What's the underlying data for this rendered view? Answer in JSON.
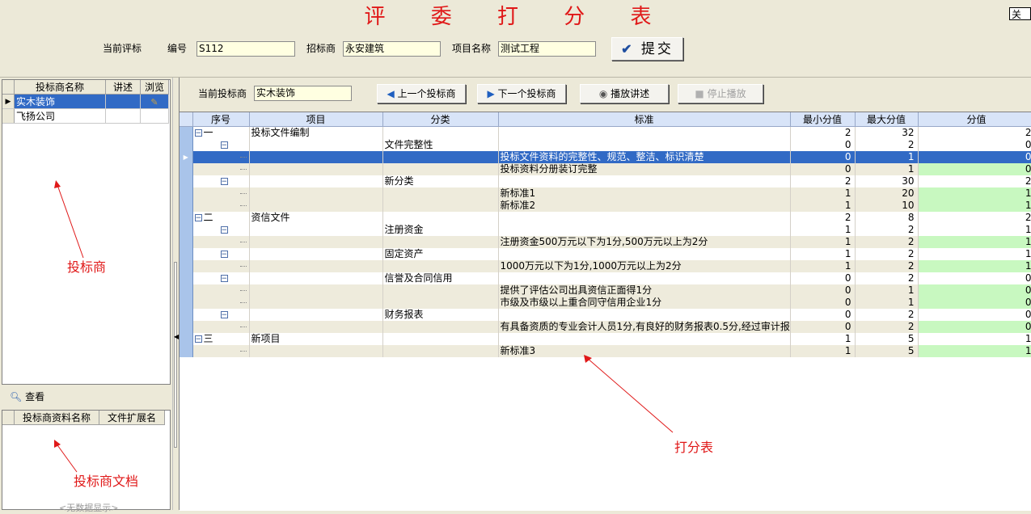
{
  "header": {
    "title": "评 委 打 分 表",
    "close_label": "关闭",
    "current_bid_label": "当前评标",
    "number_label": "编号",
    "number_value": "S112",
    "tenderer_label": "招标商",
    "tenderer_value": "永安建筑",
    "project_label": "项目名称",
    "project_value": "测试工程",
    "submit_label": "提交"
  },
  "bidders": {
    "columns": [
      "投标商名称",
      "讲述",
      "浏览"
    ],
    "rows": [
      {
        "name": "实木装饰"
      },
      {
        "name": "飞扬公司"
      }
    ],
    "annotation": "投标商"
  },
  "docs": {
    "view_label": "查看",
    "columns": [
      "投标商资料名称",
      "文件扩展名"
    ],
    "empty_text": "<无数据显示>",
    "annotation": "投标商文档"
  },
  "toolbar": {
    "current_bidder_label": "当前投标商",
    "current_bidder_value": "实木装饰",
    "prev_label": "上一个投标商",
    "next_label": "下一个投标商",
    "play_label": "播放讲述",
    "stop_label": "停止播放"
  },
  "score": {
    "columns": [
      "序号",
      "项目",
      "分类",
      "标准",
      "最小分值",
      "最大分值",
      "分值"
    ],
    "rows": [
      {
        "level": 0,
        "seq": "一",
        "project": "投标文件编制",
        "category": "",
        "standard": "",
        "min": "2",
        "max": "32",
        "score": "2"
      },
      {
        "level": 1,
        "seq": "",
        "project": "",
        "category": "文件完整性",
        "standard": "",
        "min": "0",
        "max": "2",
        "score": "0"
      },
      {
        "level": 2,
        "seq": "",
        "project": "",
        "category": "",
        "standard": "投标文件资料的完整性、规范、整洁、标识清楚",
        "min": "0",
        "max": "1",
        "score": "0",
        "selected": true
      },
      {
        "level": 2,
        "seq": "",
        "project": "",
        "category": "",
        "standard": "投标资料分册装订完整",
        "min": "0",
        "max": "1",
        "score": "0"
      },
      {
        "level": 1,
        "seq": "",
        "project": "",
        "category": "新分类",
        "standard": "",
        "min": "2",
        "max": "30",
        "score": "2"
      },
      {
        "level": 2,
        "seq": "",
        "project": "",
        "category": "",
        "standard": "新标准1",
        "min": "1",
        "max": "20",
        "score": "1"
      },
      {
        "level": 2,
        "seq": "",
        "project": "",
        "category": "",
        "standard": "新标准2",
        "min": "1",
        "max": "10",
        "score": "1"
      },
      {
        "level": 0,
        "seq": "二",
        "project": "资信文件",
        "category": "",
        "standard": "",
        "min": "2",
        "max": "8",
        "score": "2"
      },
      {
        "level": 1,
        "seq": "",
        "project": "",
        "category": "注册资金",
        "standard": "",
        "min": "1",
        "max": "2",
        "score": "1"
      },
      {
        "level": 2,
        "seq": "",
        "project": "",
        "category": "",
        "standard": "注册资金500万元以下为1分,500万元以上为2分",
        "min": "1",
        "max": "2",
        "score": "1"
      },
      {
        "level": 1,
        "seq": "",
        "project": "",
        "category": "固定资产",
        "standard": "",
        "min": "1",
        "max": "2",
        "score": "1"
      },
      {
        "level": 2,
        "seq": "",
        "project": "",
        "category": "",
        "standard": "1000万元以下为1分,1000万元以上为2分",
        "min": "1",
        "max": "2",
        "score": "1"
      },
      {
        "level": 1,
        "seq": "",
        "project": "",
        "category": "信誉及合同信用",
        "standard": "",
        "min": "0",
        "max": "2",
        "score": "0"
      },
      {
        "level": 2,
        "seq": "",
        "project": "",
        "category": "",
        "standard": "提供了评估公司出具资信正面得1分",
        "min": "0",
        "max": "1",
        "score": "0"
      },
      {
        "level": 2,
        "seq": "",
        "project": "",
        "category": "",
        "standard": "市级及市级以上重合同守信用企业1分",
        "min": "0",
        "max": "1",
        "score": "0"
      },
      {
        "level": 1,
        "seq": "",
        "project": "",
        "category": "财务报表",
        "standard": "",
        "min": "0",
        "max": "2",
        "score": "0"
      },
      {
        "level": 2,
        "seq": "",
        "project": "",
        "category": "",
        "standard": "有具备资质的专业会计人员1分,有良好的财务报表0.5分,经过审计报",
        "min": "0",
        "max": "2",
        "score": "0"
      },
      {
        "level": 0,
        "seq": "三",
        "project": "新项目",
        "category": "",
        "standard": "",
        "min": "1",
        "max": "5",
        "score": "1"
      },
      {
        "level": 2,
        "seq": "",
        "project": "",
        "category": "",
        "standard": "新标准3",
        "min": "1",
        "max": "5",
        "score": "1"
      }
    ],
    "annotation": "打分表"
  },
  "colors": {
    "title": "#e01818",
    "selection": "#316ac5",
    "score_cell": "#c8f8c0",
    "annotation": "#e01818"
  }
}
